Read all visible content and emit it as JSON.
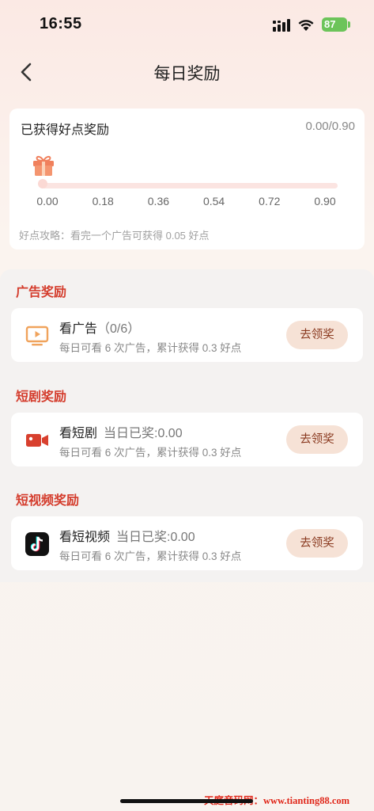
{
  "status_bar": {
    "time": "16:55",
    "battery": "87"
  },
  "nav": {
    "title": "每日奖励",
    "back_icon": "chevron-left-icon"
  },
  "summary": {
    "title": "已获得好点奖励",
    "value": "0.00/0.90",
    "progress_fraction": 0,
    "ticks": [
      "0.00",
      "0.18",
      "0.36",
      "0.54",
      "0.72",
      "0.90"
    ],
    "tip": "好点攻略：看完一个广告可获得 0.05 好点",
    "gift_icon": "gift-icon"
  },
  "sections": [
    {
      "title": "广告奖励",
      "task": {
        "icon": "tv-play-icon",
        "name": "看广告",
        "status": "（0/6）",
        "desc": "每日可看 6 次广告，累计获得 0.3 好点",
        "button": "去领奖"
      }
    },
    {
      "title": "短剧奖励",
      "task": {
        "icon": "video-camera-icon",
        "name": "看短剧",
        "status": "当日已奖:0.00",
        "desc": "每日可看 6 次广告，累计获得 0.3 好点",
        "button": "去领奖"
      }
    },
    {
      "title": "短视频奖励",
      "task": {
        "icon": "tiktok-icon",
        "name": "看短视频",
        "status": "当日已奖:0.00",
        "desc": "每日可看 6 次广告，累计获得 0.3 好点",
        "button": "去领奖"
      }
    }
  ],
  "colors": {
    "accent": "#d43c2c",
    "button_bg": "#f6e2d6",
    "progress_track": "#fbe4e1"
  },
  "watermark": "天庭音码网：www.tianting88.com"
}
